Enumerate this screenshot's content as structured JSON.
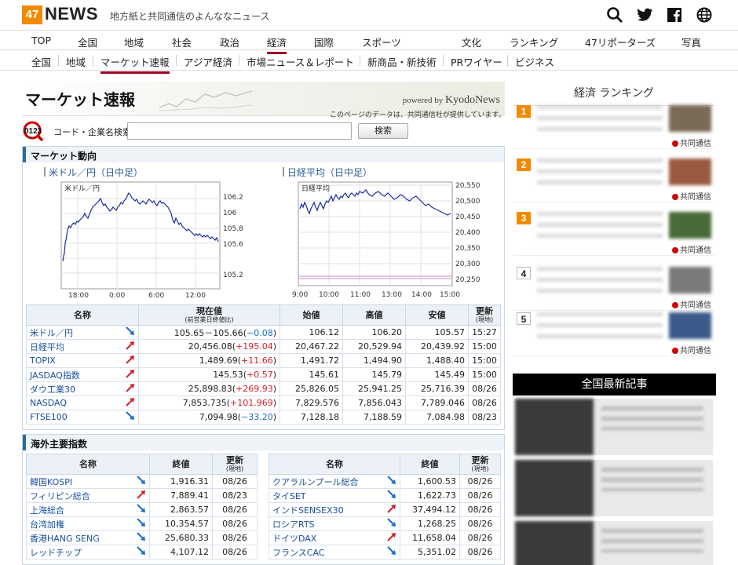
{
  "header": {
    "logo_num": "47",
    "logo_text": "NEWS",
    "tagline": "地方紙と共同通信のよんななニュース"
  },
  "nav_main": [
    "TOP",
    "全国",
    "地域",
    "社会",
    "政治",
    "経済",
    "国際",
    "スポーツ",
    "文化",
    "ランキング",
    "47リポーターズ",
    "写真"
  ],
  "nav_sub": [
    "全国",
    "地域",
    "マーケット速報",
    "アジア経済",
    "市場ニュース＆レポート",
    "新商品・新技術",
    "PRワイヤー",
    "ビジネス"
  ],
  "banner": {
    "title": "マーケット速報",
    "powered_prefix": "powered by",
    "powered_brand": "KyodoNews",
    "note": "このページのデータは、共同通信社が提供しています。"
  },
  "search": {
    "icon_text": "0123",
    "label": "コード・企業名検索",
    "value": "",
    "button": "検索"
  },
  "market": {
    "title": "マーケット動向",
    "chart1": {
      "title": "米ドル／円（日中足）",
      "inner_label": "米ドル／円",
      "ticks_y": [
        "106.2",
        "106",
        "105.8",
        "105.6",
        "105.2"
      ],
      "ticks_x": [
        "18:00",
        "0:00",
        "6:00",
        "12:00"
      ]
    },
    "chart2": {
      "title": "日経平均（日中足）",
      "inner_label": "日経平均",
      "ticks_y": [
        "20,550",
        "20,500",
        "20,450",
        "20,400",
        "20,350",
        "20,300",
        "20,250"
      ],
      "ticks_x": [
        "9:00",
        "10:00",
        "11:00",
        "13:00",
        "14:00",
        "15:00"
      ]
    },
    "table": {
      "headers": [
        "名称",
        "現在値",
        "始値",
        "高値",
        "安値",
        "更新"
      ],
      "header_subs": [
        "",
        "(前営業日終値比)",
        "",
        "",
        "",
        "(現地)"
      ],
      "rows": [
        {
          "name": "米ドル／円",
          "dir": "down",
          "cur": "105.65－105.66",
          "chg": "−0.08",
          "open": "106.12",
          "high": "106.20",
          "low": "105.57",
          "upd": "15:27"
        },
        {
          "name": "日経平均",
          "dir": "up",
          "cur": "20,456.08",
          "chg": "+195.04",
          "open": "20,467.22",
          "high": "20,529.94",
          "low": "20,439.92",
          "upd": "15:00"
        },
        {
          "name": "TOPIX",
          "dir": "up",
          "cur": "1,489.69",
          "chg": "+11.66",
          "open": "1,491.72",
          "high": "1,494.90",
          "low": "1,488.40",
          "upd": "15:00"
        },
        {
          "name": "JASDAQ指数",
          "dir": "up",
          "cur": "145.53",
          "chg": "+0.57",
          "open": "145.61",
          "high": "145.79",
          "low": "145.49",
          "upd": "15:00"
        },
        {
          "name": "ダウ工業30",
          "dir": "up",
          "cur": "25,898.83",
          "chg": "+269.93",
          "open": "25,826.05",
          "high": "25,941.25",
          "low": "25,716.39",
          "upd": "08/26"
        },
        {
          "name": "NASDAQ",
          "dir": "up",
          "cur": "7,853.735",
          "chg": "+101.969",
          "open": "7,829.576",
          "high": "7,856.043",
          "low": "7,789.046",
          "upd": "08/26"
        },
        {
          "name": "FTSE100",
          "dir": "down",
          "cur": "7,094.98",
          "chg": "−33.20",
          "open": "7,128.18",
          "high": "7,188.59",
          "low": "7,084.98",
          "upd": "08/23"
        }
      ]
    }
  },
  "overseas": {
    "title": "海外主要指数",
    "headers": [
      "名称",
      "終値",
      "更新"
    ],
    "header_sub": "(現地)",
    "left": [
      {
        "name": "韓国KOSPI",
        "dir": "down",
        "val": "1,916.31",
        "upd": "08/26"
      },
      {
        "name": "フィリピン総合",
        "dir": "up",
        "val": "7,889.41",
        "upd": "08/23"
      },
      {
        "name": "上海総合",
        "dir": "down",
        "val": "2,863.57",
        "upd": "08/26"
      },
      {
        "name": "台湾加権",
        "dir": "down",
        "val": "10,354.57",
        "upd": "08/26"
      },
      {
        "name": "香港HANG SENG",
        "dir": "down",
        "val": "25,680.33",
        "upd": "08/26"
      },
      {
        "name": "レッドチップ",
        "dir": "down",
        "val": "4,107.12",
        "upd": "08/26"
      }
    ],
    "right": [
      {
        "name": "クアラルンプール総合",
        "dir": "down",
        "val": "1,600.53",
        "upd": "08/26"
      },
      {
        "name": "タイSET",
        "dir": "down",
        "val": "1,622.73",
        "upd": "08/26"
      },
      {
        "name": "インドSENSEX30",
        "dir": "up",
        "val": "37,494.12",
        "upd": "08/26"
      },
      {
        "name": "ロシアRTS",
        "dir": "down",
        "val": "1,268.25",
        "upd": "08/26"
      },
      {
        "name": "ドイツDAX",
        "dir": "up",
        "val": "11,658.04",
        "upd": "08/26"
      },
      {
        "name": "フランスCAC",
        "dir": "down",
        "val": "5,351.02",
        "upd": "08/26"
      }
    ]
  },
  "sidebar": {
    "ranking_title": "経済 ランキング",
    "ranks": [
      "1",
      "2",
      "3",
      "4",
      "5"
    ],
    "source": "共同通信",
    "news_title": "全国最新記事"
  },
  "colors": {
    "accent": "#f28a00",
    "up": "#d4202a",
    "down": "#1a6ec8",
    "nav_active": "#a0001e"
  }
}
